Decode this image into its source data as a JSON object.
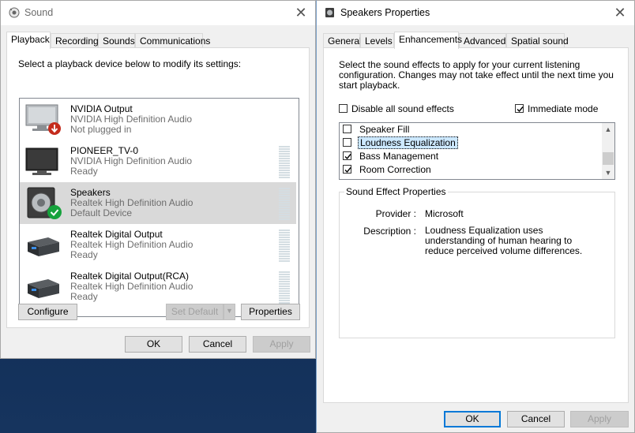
{
  "sound": {
    "title": "Sound",
    "close_glyph": "✕",
    "tabs": [
      {
        "label": "Playback"
      },
      {
        "label": "Recording"
      },
      {
        "label": "Sounds"
      },
      {
        "label": "Communications"
      }
    ],
    "instruction": "Select a playback device below to modify its settings:",
    "devices": [
      {
        "name": "NVIDIA Output",
        "driver": "NVIDIA High Definition Audio",
        "status": "Not plugged in"
      },
      {
        "name": "PIONEER_TV-0",
        "driver": "NVIDIA High Definition Audio",
        "status": "Ready"
      },
      {
        "name": "Speakers",
        "driver": "Realtek High Definition Audio",
        "status": "Default Device"
      },
      {
        "name": "Realtek Digital Output",
        "driver": "Realtek High Definition Audio",
        "status": "Ready"
      },
      {
        "name": "Realtek Digital Output(RCA)",
        "driver": "Realtek High Definition Audio",
        "status": "Ready"
      }
    ],
    "configure_label": "Configure",
    "set_default_label": "Set Default",
    "properties_label": "Properties",
    "ok_label": "OK",
    "cancel_label": "Cancel",
    "apply_label": "Apply"
  },
  "props": {
    "title": "Speakers Properties",
    "close_glyph": "✕",
    "tabs": [
      {
        "label": "General"
      },
      {
        "label": "Levels"
      },
      {
        "label": "Enhancements"
      },
      {
        "label": "Advanced"
      },
      {
        "label": "Spatial sound"
      }
    ],
    "instruction": "Select the sound effects to apply for your current listening configuration. Changes may not take effect until the next time you start playback.",
    "disable_all_label": "Disable all sound effects",
    "immediate_label": "Immediate mode",
    "effects": [
      {
        "label": "Speaker Fill",
        "checked": false
      },
      {
        "label": "Loudness Equalization",
        "checked": false
      },
      {
        "label": "Bass Management",
        "checked": true
      },
      {
        "label": "Room Correction",
        "checked": true
      }
    ],
    "group_title": "Sound Effect Properties",
    "provider_key": "Provider :",
    "provider_val": "Microsoft",
    "description_key": "Description :",
    "description_val": "Loudness Equalization uses understanding of human hearing to reduce perceived volume differences.",
    "ok_label": "OK",
    "cancel_label": "Cancel",
    "apply_label": "Apply"
  },
  "colors": {
    "accent": "#0078d7",
    "selection": "#cce8ff",
    "selected_row": "#d9d9d9",
    "status_ok": "#16a23c",
    "status_unplugged": "#c42b1c"
  }
}
